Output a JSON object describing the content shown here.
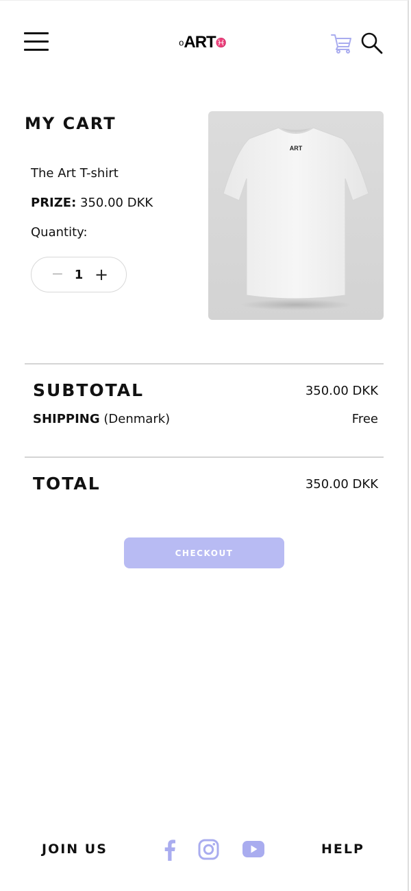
{
  "header": {
    "logo_prefix": "ο",
    "logo_text": "ART",
    "logo_suffix": "♓",
    "menu_icon": "hamburger-menu-icon",
    "cart_icon": "shopping-cart-icon",
    "search_icon": "search-icon"
  },
  "cart": {
    "title": "MY CART",
    "item": {
      "name": "The Art T-shirt",
      "price_label": "PRIZE:",
      "price_value": "350.00 DKK",
      "quantity_label": "Quantity:",
      "quantity": "1",
      "decrement_symbol": "−",
      "increment_symbol": "+",
      "image_logo": "ART"
    }
  },
  "summary": {
    "subtotal_label": "SUBTOTAL",
    "subtotal_value": "350.00 DKK",
    "shipping_label": "SHIPPING",
    "shipping_region": "(Denmark)",
    "shipping_value": "Free",
    "total_label": "TOTAL",
    "total_value": "350.00 DKK"
  },
  "checkout": {
    "label": "CHECKOUT"
  },
  "footer": {
    "join_us": "JOIN US",
    "help": "HELP",
    "social_icons": [
      "facebook-icon",
      "instagram-icon",
      "youtube-icon"
    ]
  },
  "colors": {
    "accent": "#b8bbf3",
    "accent_icon": "#a9acef",
    "text": "#111111",
    "divider": "#d4d4d4"
  }
}
